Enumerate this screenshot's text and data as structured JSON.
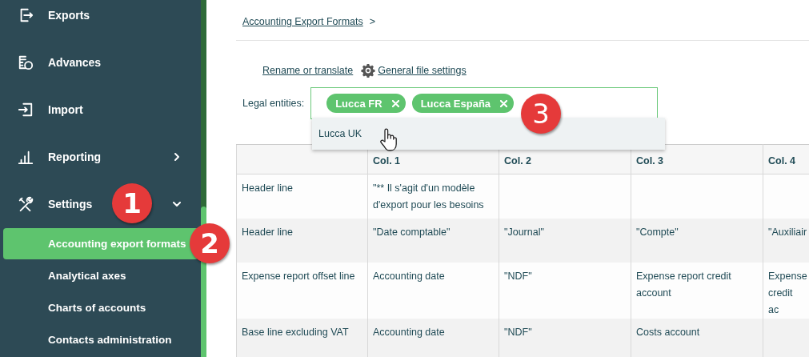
{
  "sidebar": {
    "items": [
      {
        "label": "Exports",
        "kind": "link"
      },
      {
        "label": "Advances",
        "kind": "link"
      },
      {
        "label": "Import",
        "kind": "link"
      },
      {
        "label": "Reporting",
        "kind": "group",
        "expanded": false
      },
      {
        "label": "Settings",
        "kind": "group",
        "expanded": true,
        "step": "1",
        "children": [
          {
            "label": "Accounting export formats",
            "selected": true,
            "step": "2"
          },
          {
            "label": "Analytical axes",
            "selected": false
          },
          {
            "label": "Charts of accounts",
            "selected": false
          },
          {
            "label": "Contacts administration",
            "selected": false
          }
        ]
      }
    ]
  },
  "breadcrumb": {
    "link": "Accounting Export Formats",
    "separator": ">"
  },
  "actions": [
    {
      "label": "Rename or translate",
      "kind": "plain"
    },
    {
      "label": "General file settings",
      "kind": "gear"
    }
  ],
  "legal_entities": {
    "label": "Legal entities:",
    "step": "3",
    "chips": [
      "Lucca FR",
      "Lucca España"
    ],
    "dropdown": [
      {
        "label": "Lucca UK",
        "hovered": true
      }
    ]
  },
  "table": {
    "columns": [
      "",
      "Col. 1",
      "Col. 2",
      "Col. 3",
      "Col. 4"
    ],
    "rows": [
      [
        "Header line",
        "\"** Il s'agit d'un modèle d'export pour les besoins",
        "",
        "",
        ""
      ],
      [
        "Header line",
        "\"Date comptable\"",
        "\"Journal\"",
        "\"Compte\"",
        "\"Auxiliair"
      ],
      [
        "Expense report offset line",
        "Accounting date",
        "\"NDF\"",
        "Expense report credit account",
        "Expense credit ac"
      ],
      [
        "Base line excluding VAT",
        "Accounting date",
        "\"NDF\"",
        "Costs account",
        ""
      ]
    ]
  }
}
